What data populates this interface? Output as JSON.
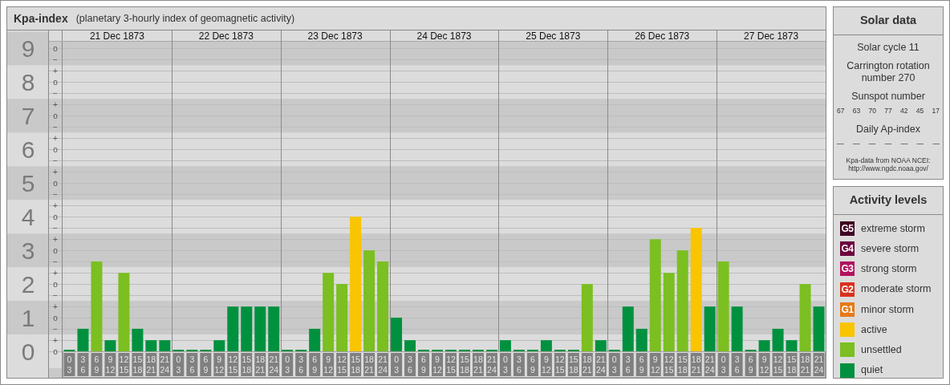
{
  "chart_panel": {
    "title": "Kpa-index",
    "subtitle": "(planetary 3-hourly index of geomagnetic activity)",
    "days": [
      "21 Dec 1873",
      "22 Dec 1873",
      "23 Dec 1873",
      "24 Dec 1873",
      "25 Dec 1873",
      "26 Dec 1873",
      "27 Dec 1873"
    ],
    "sign_marks": [
      "o",
      "−",
      "+",
      "o",
      "−",
      "+",
      "o",
      "−",
      "+",
      "o",
      "−",
      "+",
      "o",
      "−",
      "+",
      "o",
      "−",
      "+",
      "o",
      "−",
      "+",
      "o",
      "−",
      "+",
      "o",
      "−",
      "+",
      "o"
    ],
    "chart_data": {
      "type": "bar",
      "ylim": [
        0,
        9.2
      ],
      "grid": true,
      "categories": [
        "0 3",
        "3 6",
        "6 9",
        "9 12",
        "12 15",
        "15 18",
        "18 21",
        "21 24",
        "0 3",
        "3 6",
        "6 9",
        "9 12",
        "12 15",
        "15 18",
        "18 21",
        "21 24",
        "0 3",
        "3 6",
        "6 9",
        "9 12",
        "12 15",
        "15 18",
        "18 21",
        "21 24",
        "0 3",
        "3 6",
        "6 9",
        "9 12",
        "12 15",
        "15 18",
        "18 21",
        "21 24",
        "0 3",
        "3 6",
        "6 9",
        "9 12",
        "12 15",
        "15 18",
        "18 21",
        "21 24",
        "0 3",
        "3 6",
        "6 9",
        "9 12",
        "12 15",
        "15 18",
        "18 21",
        "21 24",
        "0 3",
        "3 6",
        "6 9",
        "9 12",
        "12 15",
        "15 18",
        "18 21",
        "21 24"
      ],
      "values": [
        0,
        0.67,
        2.67,
        0.33,
        2.33,
        0.67,
        0.33,
        0.33,
        0,
        0,
        0,
        0.33,
        1.33,
        1.33,
        1.33,
        1.33,
        0,
        0,
        0.67,
        2.33,
        2,
        4,
        3,
        2.67,
        1,
        0.33,
        0,
        0,
        0,
        0,
        0,
        0,
        0.33,
        0,
        0,
        0.33,
        0,
        0,
        2,
        0.33,
        0,
        1.33,
        0.67,
        3.33,
        2.33,
        3,
        3.67,
        1.33,
        2.67,
        1.33,
        0,
        0.33,
        0.67,
        0.33,
        2,
        1.33
      ],
      "yticks": [
        {
          "value": 0,
          "label": "0"
        },
        {
          "value": 1,
          "label": "1"
        },
        {
          "value": 2,
          "label": "2"
        },
        {
          "value": 3,
          "label": "3"
        },
        {
          "value": 4,
          "label": "4"
        },
        {
          "value": 5,
          "label": "5"
        },
        {
          "value": 6,
          "label": "6"
        },
        {
          "value": 7,
          "label": "7"
        },
        {
          "value": 8,
          "label": "8"
        },
        {
          "value": 9,
          "label": "9"
        }
      ]
    }
  },
  "solar_data": {
    "title": "Solar data",
    "solar_cycle": "Solar cycle 11",
    "carrington_rotation": "Carrington rotation number 270",
    "sunspot_label": "Sunspot number",
    "sunspot_numbers": [
      "67",
      "63",
      "70",
      "77",
      "42",
      "45",
      "17"
    ],
    "ap_label": "Daily Ap-index",
    "ap_values": [
      "—",
      "—",
      "—",
      "—",
      "—",
      "—",
      "—"
    ],
    "source": "Kpa-data from NOAA NCEI: http://www.ngdc.noaa.gov/"
  },
  "activity_levels": {
    "title": "Activity levels",
    "items": [
      {
        "badge": "G5",
        "label": "extreme storm",
        "color": "#3f0021"
      },
      {
        "badge": "G4",
        "label": "severe storm",
        "color": "#6b003d"
      },
      {
        "badge": "G3",
        "label": "strong storm",
        "color": "#b3125e"
      },
      {
        "badge": "G2",
        "label": "moderate storm",
        "color": "#d9301c"
      },
      {
        "badge": "G1",
        "label": "minor storm",
        "color": "#e67a17"
      },
      {
        "label": "active",
        "color": "#f9c400"
      },
      {
        "label": "unsettled",
        "color": "#7bbf21"
      },
      {
        "label": "quiet",
        "color": "#00913f"
      }
    ]
  }
}
